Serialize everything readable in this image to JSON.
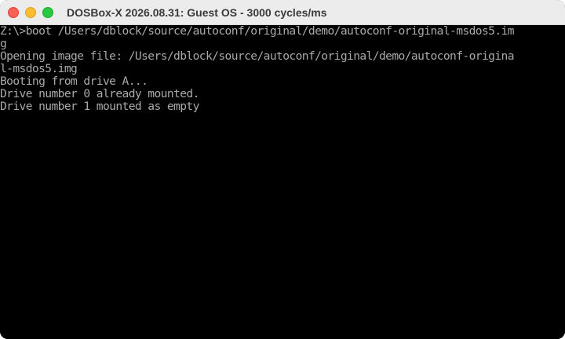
{
  "window": {
    "title": "DOSBox-X 2026.08.31: Guest OS - 3000 cycles/ms"
  },
  "console": {
    "lines": [
      "Z:\\>boot /Users/dblock/source/autoconf/original/demo/autoconf-original-msdos5.im",
      "g",
      "Opening image file: /Users/dblock/source/autoconf/original/demo/autoconf-origina",
      "l-msdos5.img",
      "Booting from drive A...",
      "Drive number 0 already mounted.",
      "Drive number 1 mounted as empty"
    ]
  },
  "colors": {
    "console_background": "#000000",
    "console_text": "#aaaaaa",
    "close_button": "#fe5f57",
    "minimize_button": "#febc2e",
    "zoom_button": "#28c840"
  }
}
